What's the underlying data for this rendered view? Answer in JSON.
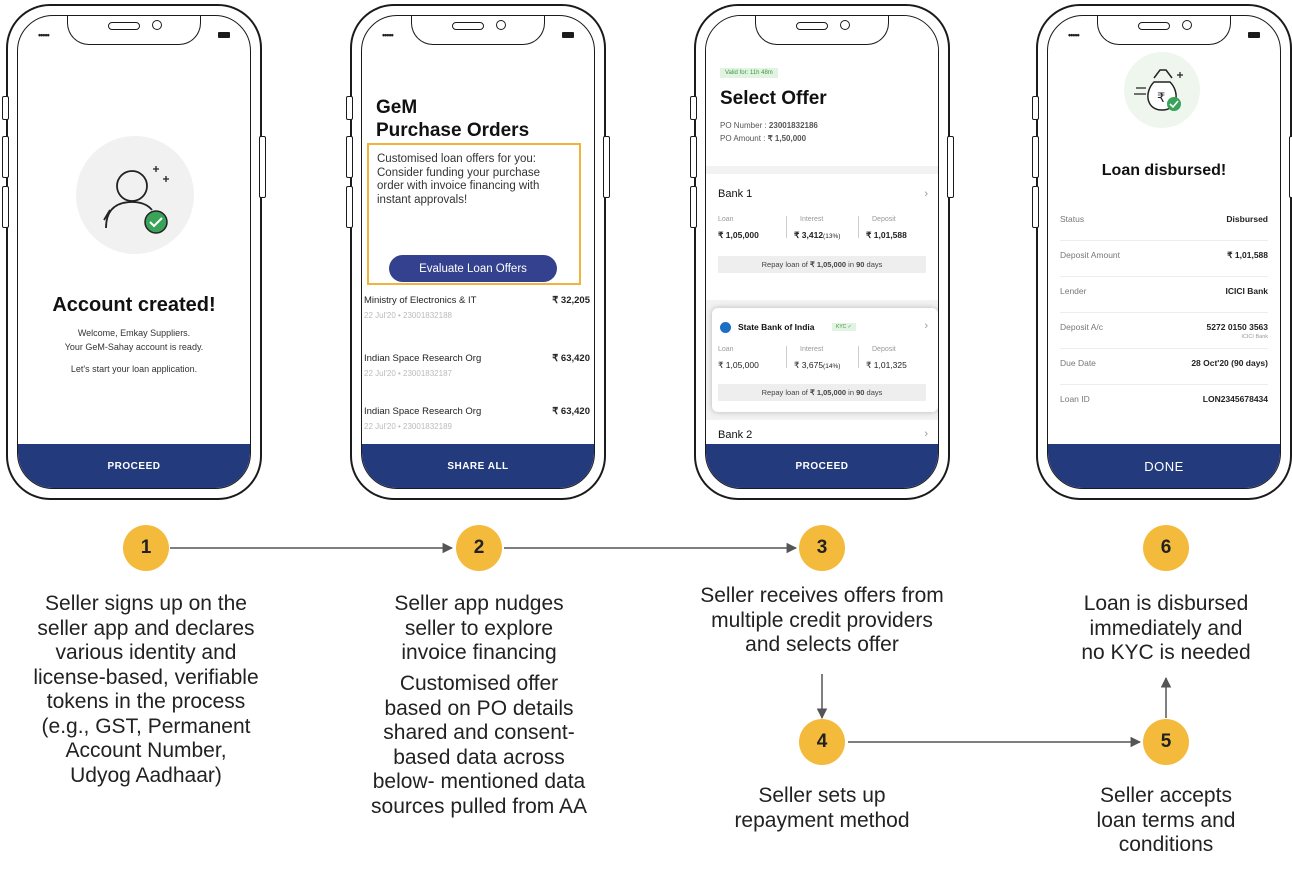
{
  "phone1": {
    "bottom": "PROCEED",
    "title": "Account created!",
    "line1": "Welcome, Emkay Suppliers.",
    "line2": "Your GeM-Sahay account is ready.",
    "line3": "Let's start your loan application."
  },
  "phone2": {
    "title1": "GeM",
    "title2": "Purchase Orders",
    "box_text": "Customised loan offers for you: Consider funding your purchase order with invoice financing with instant approvals!",
    "button": "Evaluate Loan Offers",
    "rows": [
      {
        "org": "Ministry of Electronics & IT",
        "amount": "₹ 32,205",
        "sub": "22 Jul'20 • 23001832188"
      },
      {
        "org": "Indian Space Research Org",
        "amount": "₹ 63,420",
        "sub": "22 Jul'20 • 23001832187"
      },
      {
        "org": "Indian Space Research Org",
        "amount": "₹ 63,420",
        "sub": "22 Jul'20 • 23001832189"
      }
    ],
    "bottom": "SHARE ALL"
  },
  "phone3": {
    "valid": "Valid for: 11h 48m",
    "title": "Select Offer",
    "po_number_label": "PO Number :",
    "po_number": "23001832186",
    "po_amount_label": "PO Amount :",
    "po_amount": "₹ 1,50,000",
    "loan_label": "Loan",
    "interest_label": "Interest",
    "deposit_label": "Deposit",
    "bank1": {
      "name": "Bank 1",
      "loan": "₹ 1,05,000",
      "interest": "₹ 3,412",
      "rate": "(13%)",
      "deposit": "₹ 1,01,588",
      "repay_pre": "Repay loan of",
      "repay_amt": "₹ 1,05,000",
      "repay_in": "in",
      "repay_days": "90",
      "repay_post": "days"
    },
    "sbi": {
      "name": "State Bank of India",
      "tag": "KYC ✓",
      "loan": "₹ 1,05,000",
      "interest": "₹ 3,675",
      "rate": "(14%)",
      "deposit": "₹ 1,01,325",
      "repay_pre": "Repay loan of",
      "repay_amt": "₹ 1,05,000",
      "repay_in": "in",
      "repay_days": "90",
      "repay_post": "days"
    },
    "bank2": "Bank 2",
    "bottom": "PROCEED"
  },
  "phone6": {
    "title": "Loan disbursed!",
    "rows": [
      {
        "label": "Status",
        "value": "Disbursed",
        "sub": ""
      },
      {
        "label": "Deposit Amount",
        "value": "₹ 1,01,588",
        "sub": ""
      },
      {
        "label": "Lender",
        "value": "ICICI Bank",
        "sub": ""
      },
      {
        "label": "Deposit A/c",
        "value": "5272 0150 3563",
        "sub": "ICICI Bank"
      },
      {
        "label": "Due Date",
        "value": "28 Oct'20 (90 days)",
        "sub": ""
      },
      {
        "label": "Loan ID",
        "value": "LON2345678434",
        "sub": ""
      }
    ],
    "bottom": "DONE"
  },
  "steps": {
    "s1": {
      "num": "1",
      "caption": [
        "Seller signs up on the",
        "seller app and declares",
        "various identity and",
        "license-based, verifiable",
        "tokens in the process",
        "(e.g., GST, Permanent",
        "Account Number,",
        "Udyog Aadhaar)"
      ]
    },
    "s2": {
      "num": "2",
      "caption": [
        "Seller app nudges",
        "seller to explore",
        "invoice financing"
      ],
      "caption2": [
        "Customised offer",
        "based on PO details",
        "shared and consent-",
        "based data across",
        "below- mentioned data",
        "sources pulled from AA"
      ]
    },
    "s3": {
      "num": "3",
      "caption": [
        "Seller receives offers from",
        "multiple credit providers",
        "and selects offer"
      ]
    },
    "s4": {
      "num": "4",
      "caption": [
        "Seller sets up",
        "repayment method"
      ]
    },
    "s5": {
      "num": "5",
      "caption": [
        "Seller accepts",
        "loan terms and",
        "conditions"
      ]
    },
    "s6": {
      "num": "6",
      "caption": [
        "Loan is disbursed",
        "immediately and",
        "no KYC is needed"
      ]
    }
  },
  "colors": {
    "step": "#f4ba3c",
    "bar": "#233a7c",
    "button": "#33418f",
    "highlight": "#f2b33d",
    "arrow": "#555555"
  }
}
